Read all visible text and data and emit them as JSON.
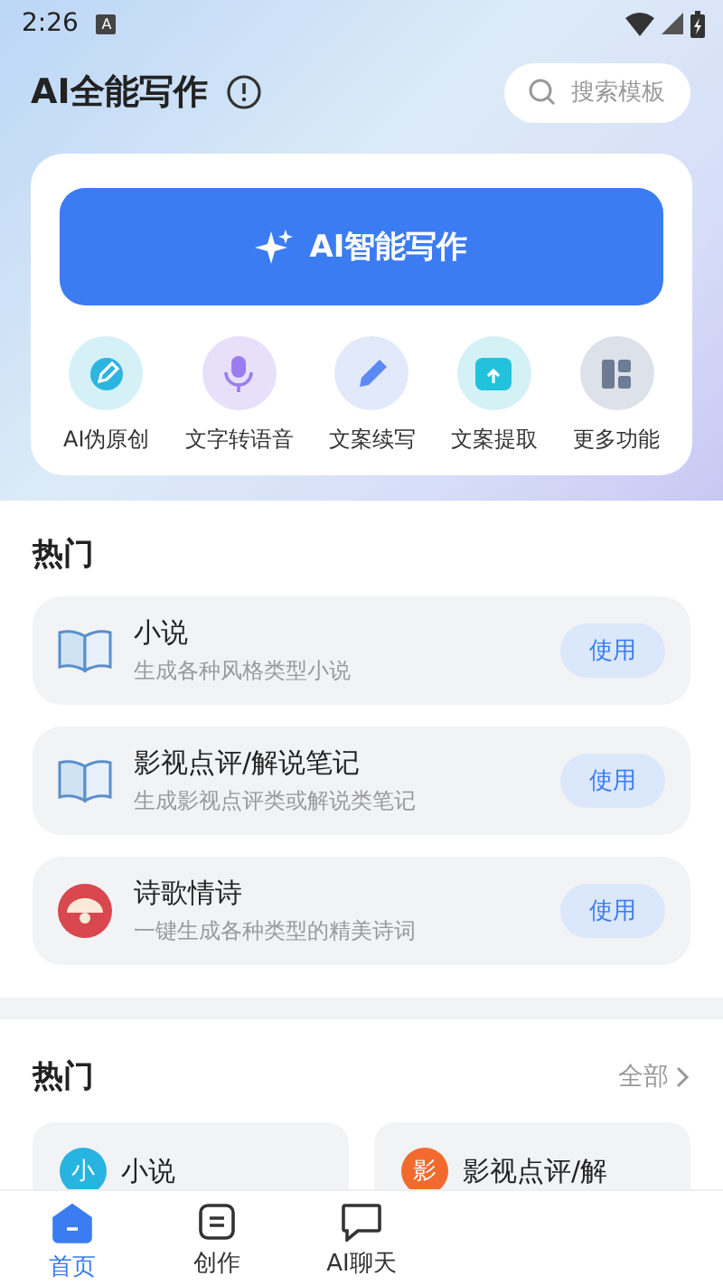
{
  "status_bar": {
    "time": "2:26",
    "notification": "A"
  },
  "header": {
    "title": "AI全能写作",
    "search": {
      "placeholder": "搜索模板"
    }
  },
  "main_card": {
    "primary_button": "AI智能写作",
    "tools": [
      {
        "label": "AI伪原创",
        "kind": "rewrite"
      },
      {
        "label": "文字转语音",
        "kind": "voice"
      },
      {
        "label": "文案续写",
        "kind": "continue"
      },
      {
        "label": "文案提取",
        "kind": "extract"
      },
      {
        "label": "更多功能",
        "kind": "more"
      }
    ]
  },
  "hot_list": {
    "title": "热门",
    "items": [
      {
        "title": "小说",
        "description": "生成各种风格类型小说",
        "kind": "book",
        "button": "使用"
      },
      {
        "title": "影视点评/解说笔记",
        "description": "生成影视点评类或解说类笔记",
        "kind": "book",
        "button": "使用"
      },
      {
        "title": "诗歌情诗",
        "description": "一键生成各种类型的精美诗词",
        "kind": "poem",
        "button": "使用"
      }
    ]
  },
  "hot_grid": {
    "title": "热门",
    "more": "全部",
    "items": [
      {
        "title": "小说",
        "badge": "小",
        "color": "#27b4e0"
      },
      {
        "title": "影视点评/解",
        "badge": "影",
        "color": "#f26a2e"
      }
    ]
  },
  "bottom_nav": [
    {
      "label": "首页",
      "kind": "home",
      "selected": true
    },
    {
      "label": "创作",
      "kind": "create",
      "selected": false
    },
    {
      "label": "AI聊天",
      "kind": "chat",
      "selected": false
    }
  ]
}
